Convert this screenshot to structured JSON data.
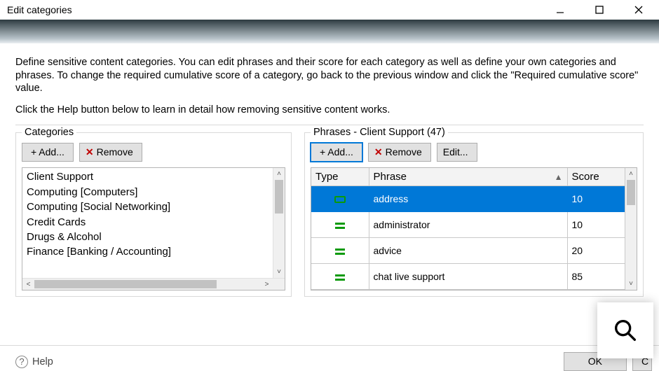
{
  "window": {
    "title": "Edit categories"
  },
  "description": {
    "p1": "Define sensitive content categories. You can edit phrases and their score for each category as well as define your own categories and phrases. To change the required cumulative score of a category, go back to the previous window and click the \"Required cumulative score\" value.",
    "p2": "Click the Help button below to learn in detail how removing sensitive content works."
  },
  "categories": {
    "legend": "Categories",
    "buttons": {
      "add": "+ Add...",
      "remove": "Remove"
    },
    "items": [
      "Client Support",
      "Computing [Computers]",
      "Computing [Social  Networking]",
      "Credit Cards",
      "Drugs & Alcohol",
      "Finance [Banking / Accounting]"
    ]
  },
  "phrases": {
    "legend": "Phrases - Client Support (47)",
    "buttons": {
      "add": "+ Add...",
      "remove": "Remove",
      "edit": "Edit..."
    },
    "columns": {
      "type": "Type",
      "phrase": "Phrase",
      "score": "Score"
    },
    "rows": [
      {
        "icon": "box",
        "phrase": "address",
        "score": "10",
        "selected": true
      },
      {
        "icon": "equal",
        "phrase": "administrator",
        "score": "10"
      },
      {
        "icon": "stack",
        "phrase": "advice",
        "score": "20"
      },
      {
        "icon": "equal",
        "phrase": "chat live support",
        "score": "85"
      }
    ]
  },
  "footer": {
    "help": "Help",
    "ok": "OK"
  }
}
